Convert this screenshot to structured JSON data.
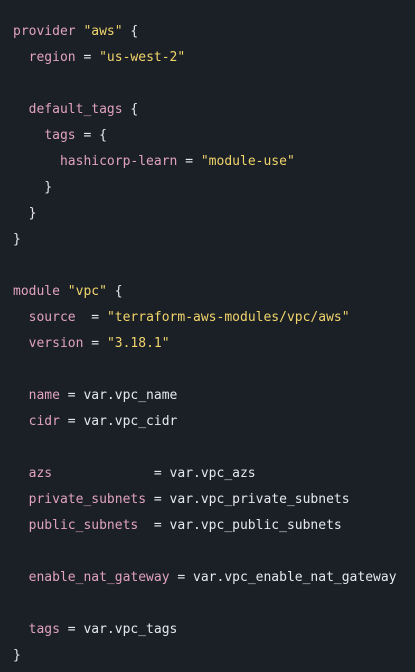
{
  "code": {
    "lines": [
      [
        {
          "t": "kw",
          "v": "provider"
        },
        {
          "t": "plain",
          "v": " "
        },
        {
          "t": "str",
          "v": "\"aws\""
        },
        {
          "t": "plain",
          "v": " {"
        }
      ],
      [
        {
          "t": "plain",
          "v": "  "
        },
        {
          "t": "kw",
          "v": "region"
        },
        {
          "t": "plain",
          "v": " = "
        },
        {
          "t": "str",
          "v": "\"us-west-2\""
        }
      ],
      [],
      [
        {
          "t": "plain",
          "v": "  "
        },
        {
          "t": "kw",
          "v": "default_tags"
        },
        {
          "t": "plain",
          "v": " {"
        }
      ],
      [
        {
          "t": "plain",
          "v": "    "
        },
        {
          "t": "kw",
          "v": "tags"
        },
        {
          "t": "plain",
          "v": " = {"
        }
      ],
      [
        {
          "t": "plain",
          "v": "      "
        },
        {
          "t": "kw",
          "v": "hashicorp-learn"
        },
        {
          "t": "plain",
          "v": " = "
        },
        {
          "t": "str",
          "v": "\"module-use\""
        }
      ],
      [
        {
          "t": "plain",
          "v": "    }"
        }
      ],
      [
        {
          "t": "plain",
          "v": "  }"
        }
      ],
      [
        {
          "t": "plain",
          "v": "}"
        }
      ],
      [],
      [
        {
          "t": "kw",
          "v": "module"
        },
        {
          "t": "plain",
          "v": " "
        },
        {
          "t": "str",
          "v": "\"vpc\""
        },
        {
          "t": "plain",
          "v": " {"
        }
      ],
      [
        {
          "t": "plain",
          "v": "  "
        },
        {
          "t": "kw",
          "v": "source"
        },
        {
          "t": "plain",
          "v": "  = "
        },
        {
          "t": "str",
          "v": "\"terraform-aws-modules/vpc/aws\""
        }
      ],
      [
        {
          "t": "plain",
          "v": "  "
        },
        {
          "t": "kw",
          "v": "version"
        },
        {
          "t": "plain",
          "v": " = "
        },
        {
          "t": "str",
          "v": "\"3.18.1\""
        }
      ],
      [],
      [
        {
          "t": "plain",
          "v": "  "
        },
        {
          "t": "kw",
          "v": "name"
        },
        {
          "t": "plain",
          "v": " = var.vpc_name"
        }
      ],
      [
        {
          "t": "plain",
          "v": "  "
        },
        {
          "t": "kw",
          "v": "cidr"
        },
        {
          "t": "plain",
          "v": " = var.vpc_cidr"
        }
      ],
      [],
      [
        {
          "t": "plain",
          "v": "  "
        },
        {
          "t": "kw",
          "v": "azs"
        },
        {
          "t": "plain",
          "v": "             = var.vpc_azs"
        }
      ],
      [
        {
          "t": "plain",
          "v": "  "
        },
        {
          "t": "kw",
          "v": "private_subnets"
        },
        {
          "t": "plain",
          "v": " = var.vpc_private_subnets"
        }
      ],
      [
        {
          "t": "plain",
          "v": "  "
        },
        {
          "t": "kw",
          "v": "public_subnets"
        },
        {
          "t": "plain",
          "v": "  = var.vpc_public_subnets"
        }
      ],
      [],
      [
        {
          "t": "plain",
          "v": "  "
        },
        {
          "t": "kw",
          "v": "enable_nat_gateway"
        },
        {
          "t": "plain",
          "v": " = var.vpc_enable_nat_gateway"
        }
      ],
      [],
      [
        {
          "t": "plain",
          "v": "  "
        },
        {
          "t": "kw",
          "v": "tags"
        },
        {
          "t": "plain",
          "v": " = var.vpc_tags"
        }
      ],
      [
        {
          "t": "plain",
          "v": "}"
        }
      ]
    ]
  }
}
